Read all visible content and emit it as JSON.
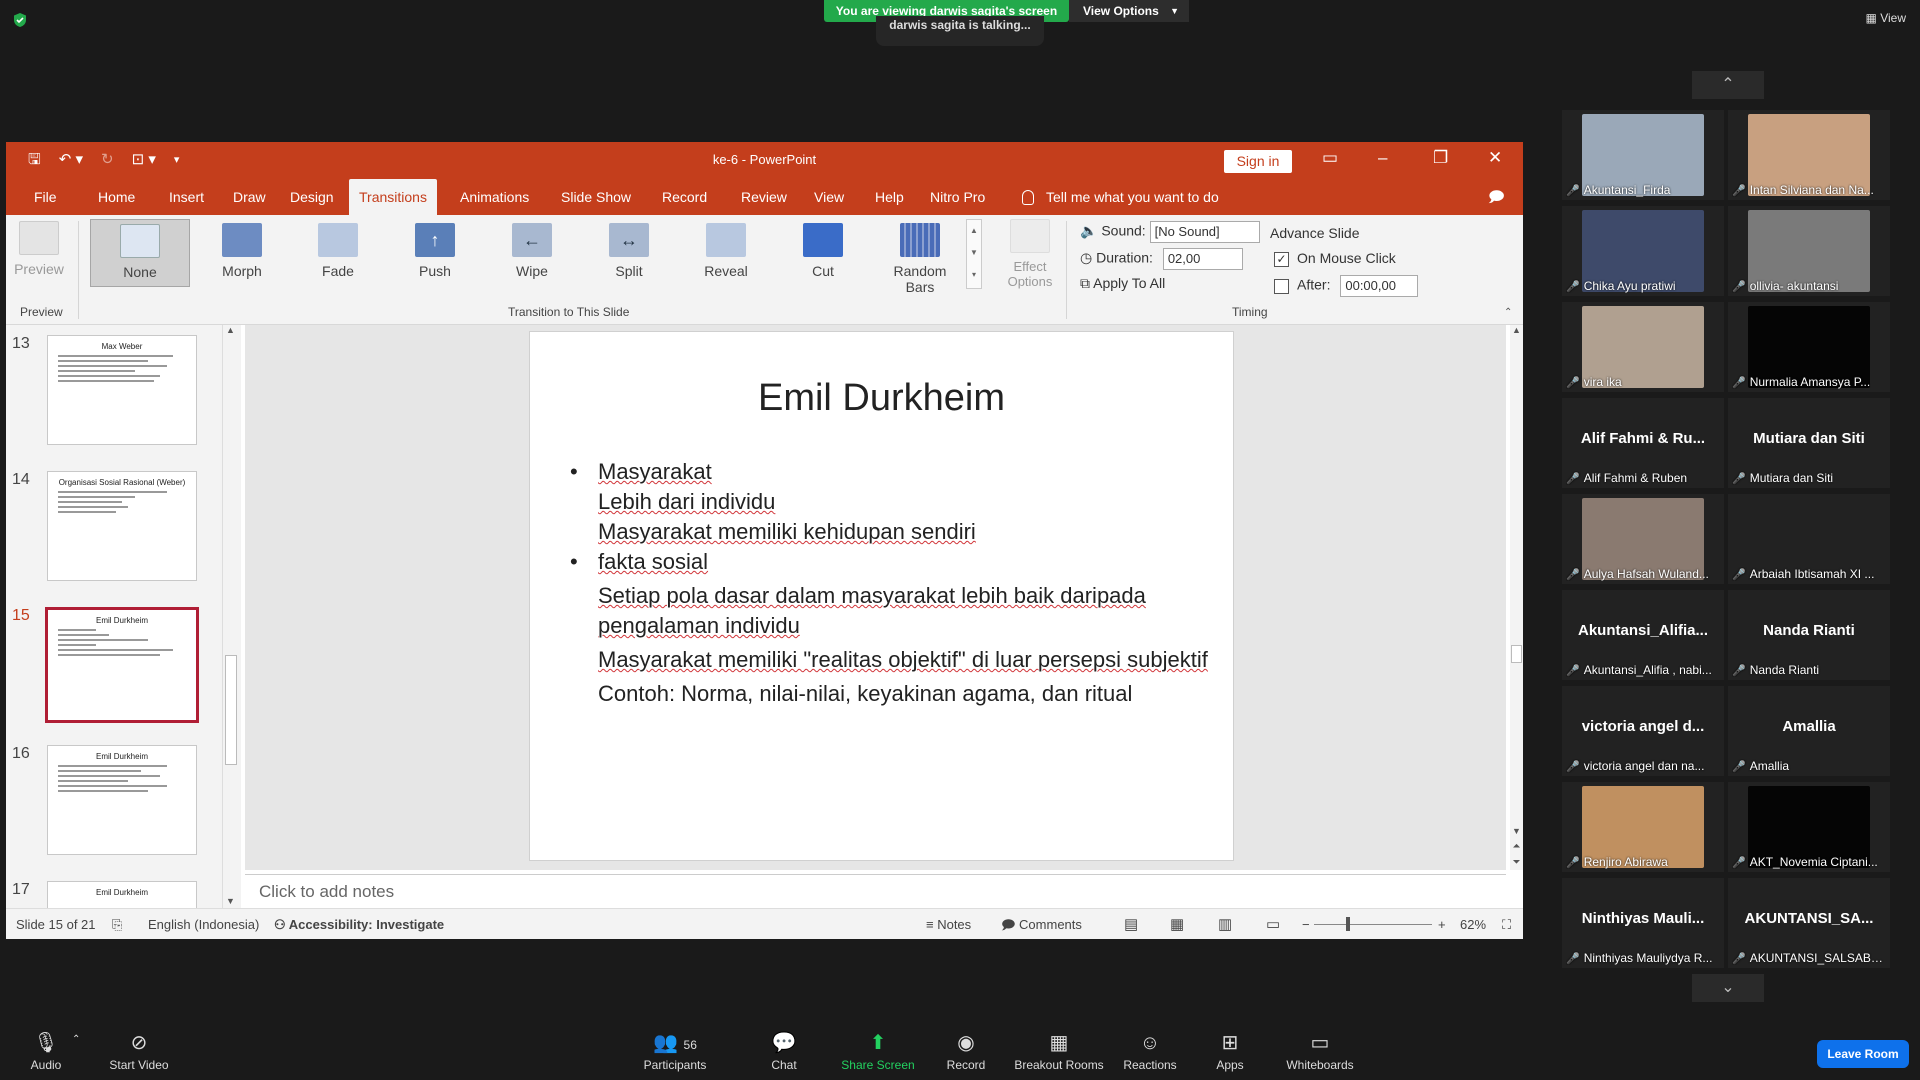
{
  "zoom": {
    "banner": "You are viewing darwis sagita's screen",
    "view_options": "View Options",
    "talking": "darwis sagita is talking...",
    "view": "View",
    "leave": "Leave Room",
    "participants_count": "56",
    "toolbar": {
      "audio": "Audio",
      "start_video": "Start Video",
      "participants": "Participants",
      "chat": "Chat",
      "share_screen": "Share Screen",
      "record": "Record",
      "breakout": "Breakout Rooms",
      "reactions": "Reactions",
      "apps": "Apps",
      "whiteboards": "Whiteboards"
    },
    "gallery": [
      {
        "name": "Akuntansi_Firda",
        "video": true,
        "color": "#9aa8b8"
      },
      {
        "name": "Intan Silviana dan Na...",
        "video": true,
        "color": "#c8a080"
      },
      {
        "name": "Chika Ayu pratiwi",
        "video": true,
        "color": "#3e4a6a"
      },
      {
        "name": "ollivia- akuntansi",
        "video": true,
        "color": "#7a7a7a"
      },
      {
        "name": "vira ika",
        "video": true,
        "color": "#b0a090"
      },
      {
        "name": "Nurmalia Amansya P...",
        "video": true,
        "color": "#050505"
      },
      {
        "name": "Alif Fahmi & Ruben",
        "video": false,
        "big": "Alif Fahmi & Ru..."
      },
      {
        "name": "Mutiara dan Siti",
        "video": false,
        "big": "Mutiara dan Siti"
      },
      {
        "name": "Aulya Hafsah Wuland...",
        "video": true,
        "color": "#8a7a70"
      },
      {
        "name": "Arbaiah Ibtisamah XI ...",
        "video": true,
        "color": "#222"
      },
      {
        "name": "Akuntansi_Alifia , nabi...",
        "video": false,
        "big": "Akuntansi_Alifia..."
      },
      {
        "name": "Nanda Rianti",
        "video": false,
        "big": "Nanda Rianti"
      },
      {
        "name": "victoria angel dan na...",
        "video": false,
        "big": "victoria angel d..."
      },
      {
        "name": "Amallia",
        "video": false,
        "big": "Amallia"
      },
      {
        "name": "Renjiro Abirawa",
        "video": true,
        "color": "#c09060"
      },
      {
        "name": "AKT_Novemia Ciptani...",
        "video": true,
        "color": "#050505"
      },
      {
        "name": "Ninthiyas Mauliydya R...",
        "video": false,
        "big": "Ninthiyas Mauli..."
      },
      {
        "name": "AKUNTANSI_SALSABIL...",
        "video": false,
        "big": "AKUNTANSI_SA..."
      }
    ]
  },
  "ppt": {
    "title": "ke-6  -  PowerPoint",
    "signin": "Sign in",
    "tabs": [
      "File",
      "Home",
      "Insert",
      "Draw",
      "Design",
      "Transitions",
      "Animations",
      "Slide Show",
      "Record",
      "Review",
      "View",
      "Help",
      "Nitro Pro"
    ],
    "active_tab": "Transitions",
    "tellme": "Tell me what you want to do",
    "ribbon": {
      "preview": "Preview",
      "preview_group": "Preview",
      "transitions": [
        "None",
        "Morph",
        "Fade",
        "Push",
        "Wipe",
        "Split",
        "Reveal",
        "Cut",
        "Random Bars"
      ],
      "effect_options_1": "Effect",
      "effect_options_2": "Options",
      "transition_group": "Transition to This Slide",
      "sound_label": "Sound:",
      "sound_value": "[No Sound]",
      "duration_label": "Duration:",
      "duration_value": "02,00",
      "apply_all": "Apply To All",
      "advance_slide": "Advance Slide",
      "on_mouse_click": "On Mouse Click",
      "after_label": "After:",
      "after_value": "00:00,00",
      "timing_group": "Timing"
    },
    "thumbnails": [
      {
        "num": "13",
        "title": "Max Weber",
        "lines": 8
      },
      {
        "num": "14",
        "title": "Organisasi Sosial Rasional (Weber)",
        "lines": 9
      },
      {
        "num": "15",
        "title": "Emil Durkheim",
        "lines": 9,
        "active": true
      },
      {
        "num": "16",
        "title": "Emil Durkheim",
        "lines": 9
      },
      {
        "num": "17",
        "title": "Emil Durkheim",
        "lines": 1
      }
    ],
    "slide": {
      "title": "Emil Durkheim",
      "b1": "Masyarakat",
      "s1": "Lebih dari individu",
      "s2": "Masyarakat memiliki kehidupan sendiri",
      "b2": "fakta sosial",
      "s3": "Setiap pola dasar dalam masyarakat lebih baik daripada pengalaman individu",
      "s4": "Masyarakat memiliki \"realitas objektif\" di luar persepsi subjektif",
      "s5": "Contoh: Norma, nilai-nilai, keyakinan agama, dan ritual"
    },
    "notes_placeholder": "Click to add notes",
    "status": {
      "slide": "Slide 15 of 21",
      "language": "English (Indonesia)",
      "accessibility": "Accessibility: Investigate",
      "notes": "Notes",
      "comments": "Comments",
      "zoom": "62%"
    }
  }
}
